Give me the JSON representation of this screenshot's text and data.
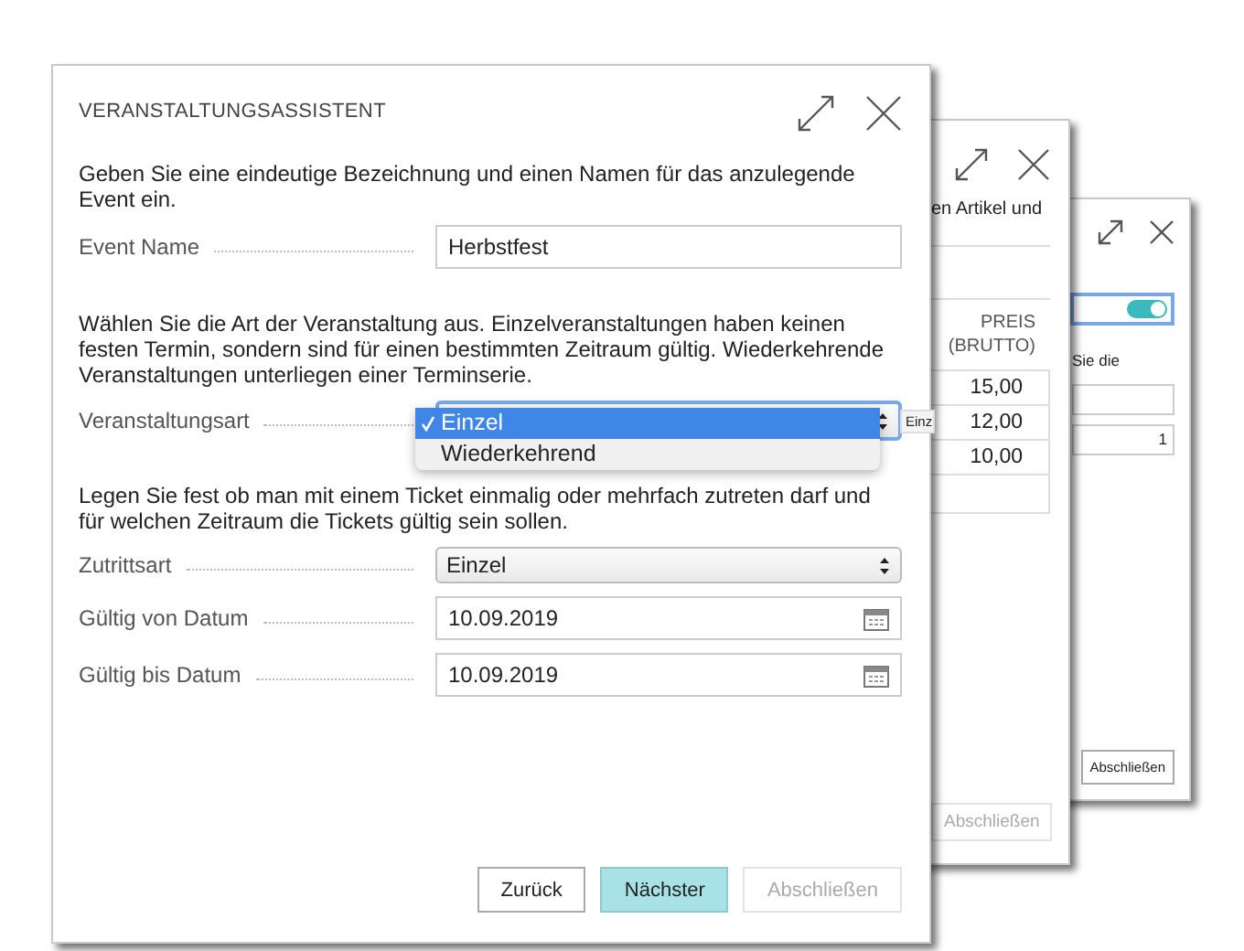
{
  "back_windows": [
    {
      "kind": "prices",
      "intro": "en Artikel und",
      "column_header": "PREIS (BRUTTO)",
      "prices": [
        "15,00",
        "12,00",
        "10,00"
      ],
      "button": {
        "label": "Abschließen",
        "disabled": true
      }
    },
    {
      "kind": "settings",
      "toggle": {
        "on": true
      },
      "text": "Sie die",
      "field_value": "1",
      "button": {
        "label": "Abschließen",
        "disabled": false
      }
    }
  ],
  "window": {
    "title": "VERANSTALTUNGSASSISTENT"
  },
  "sections": [
    {
      "text": "Geben Sie eine eindeutige Bezeichnung und einen Namen für das anzulegende Event ein.",
      "fields": [
        {
          "kind": "text",
          "label": "Event Name",
          "value": "Herbstfest"
        }
      ]
    },
    {
      "text": "Wählen Sie die Art der Veranstaltung aus. Einzelveranstaltungen haben keinen festen Termin, sondern sind für einen bestimmten Zeitraum gültig. Wiederkehrende Veranstaltungen unterliegen einer Terminserie.",
      "fields": [
        {
          "kind": "open-select",
          "label": "Veranstaltungsart",
          "peek": "Einz",
          "options": [
            {
              "label": "Einzel",
              "selected": true
            },
            {
              "label": "Wiederkehrend",
              "selected": false
            }
          ]
        }
      ]
    },
    {
      "text": "Legen Sie fest ob man mit einem Ticket einmalig oder mehrfach zutreten darf und für welchen Zeitraum die Tickets gültig sein sollen.",
      "fields": [
        {
          "kind": "select",
          "label": "Zutrittsart",
          "value": "Einzel"
        },
        {
          "kind": "date",
          "label": "Gültig von Datum",
          "value": "10.09.2019"
        },
        {
          "kind": "date",
          "label": "Gültig bis Datum",
          "value": "10.09.2019"
        }
      ]
    }
  ],
  "buttons": [
    {
      "label": "Zurück",
      "primary": false,
      "disabled": false
    },
    {
      "label": "Nächster",
      "primary": true,
      "disabled": false
    },
    {
      "label": "Abschließen",
      "primary": false,
      "disabled": true
    }
  ]
}
